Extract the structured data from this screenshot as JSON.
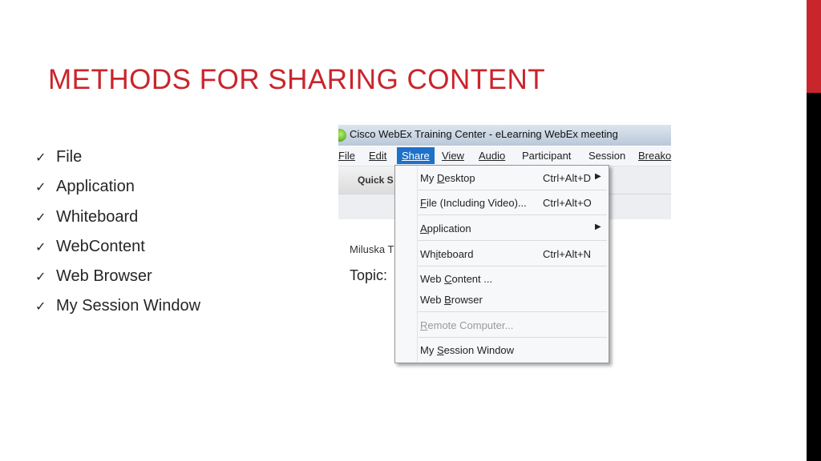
{
  "slide": {
    "title": "METHODS FOR SHARING CONTENT",
    "bullets": [
      "File",
      "Application",
      "Whiteboard",
      "WebContent",
      "Web Browser",
      "My Session Window"
    ],
    "check_glyph": "✓",
    "accent_color": "#c9252c"
  },
  "window": {
    "title": "Cisco WebEx Training Center - eLearning WebEx meeting",
    "menu": {
      "file": "File",
      "edit": "Edit",
      "share": "Share",
      "view": "View",
      "audio": "Audio",
      "participant": "Participant",
      "session": "Session",
      "breakout": "Breako"
    },
    "toolbar": {
      "quick_start": "Quick S"
    },
    "host_name": "Miluska T",
    "topic_label": "Topic:"
  },
  "share_menu": {
    "my_desktop": {
      "pre": "My ",
      "u": "D",
      "post": "esktop",
      "shortcut": "Ctrl+Alt+D"
    },
    "file": {
      "pre": "",
      "u": "F",
      "post": "ile (Including Video)...",
      "shortcut": "Ctrl+Alt+O"
    },
    "application": {
      "pre": "",
      "u": "A",
      "post": "pplication"
    },
    "whiteboard": {
      "pre": "Wh",
      "u": "i",
      "post": "teboard",
      "shortcut": "Ctrl+Alt+N"
    },
    "web_content": {
      "pre": "Web ",
      "u": "C",
      "post": "ontent ..."
    },
    "web_browser": {
      "pre": "Web ",
      "u": "B",
      "post": "rowser"
    },
    "remote_computer": {
      "pre": "",
      "u": "R",
      "post": "emote Computer..."
    },
    "my_session_window": {
      "pre": "My ",
      "u": "S",
      "post": "ession Window"
    }
  }
}
